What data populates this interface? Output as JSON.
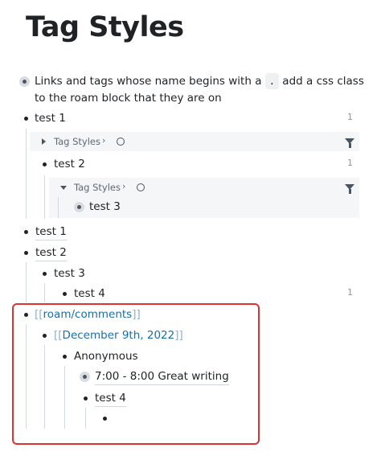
{
  "page": {
    "title": "Tag Styles"
  },
  "blocks": {
    "intro_line1_a": "Links and tags whose name begins with a",
    "intro_code": ".",
    "intro_line1_b": "add a css class",
    "intro_line2": "to the roam block that they are on",
    "test1": "test 1",
    "test1_count": "1",
    "ref1_title": "Tag Styles",
    "ref1_chevron": "›",
    "test2_nested": "test 2",
    "test2_count": "1",
    "ref2_title": "Tag Styles",
    "ref2_chevron": "›",
    "test3_nested": "test 3",
    "test1_b": "test 1",
    "test2_b": "test 2",
    "test3_b": "test 3",
    "test4": "test 4",
    "test4_count": "1",
    "open_bracket": "[[",
    "close_bracket": "]]",
    "roam_comments": "roam/comments",
    "december": "December 9th, 2022",
    "anonymous": "Anonymous",
    "comment": "7:00 - 8:00 Great writing",
    "test4_b": "test 4"
  },
  "icons": {
    "expand": "triangle-right-icon",
    "collapse": "triangle-down-icon",
    "circle": "circle-icon",
    "filter": "filter-icon"
  },
  "colors": {
    "highlight_box": "#e03131",
    "link": "#1a6ea8",
    "bracket": "#8fb0c9"
  }
}
